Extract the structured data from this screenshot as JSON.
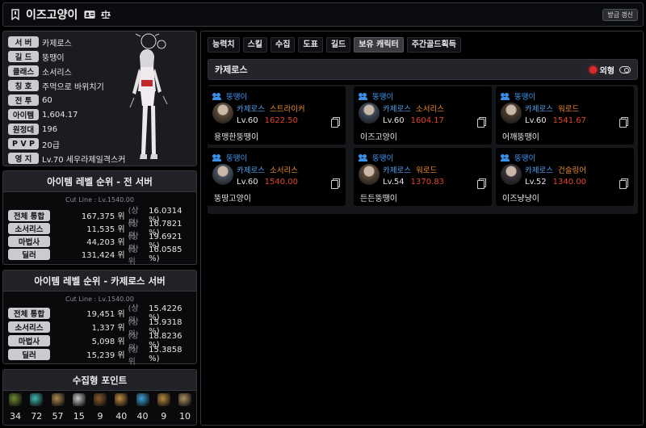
{
  "header": {
    "title": "이즈고양이",
    "refresh_label": "방금 갱신"
  },
  "profile": {
    "rows": [
      {
        "label": "서 버",
        "value": "카제로스"
      },
      {
        "label": "길 드",
        "value": "뚱땡이"
      },
      {
        "label": "클래스",
        "value": "소서리스"
      },
      {
        "label": "칭 호",
        "value": "주먹으로 바위치기"
      },
      {
        "label": "전 투",
        "value": "60"
      },
      {
        "label": "아이템",
        "value": "1,604.17"
      },
      {
        "label": "원정대",
        "value": "196"
      },
      {
        "label": "P V P",
        "value": "20급"
      },
      {
        "label": "영 지",
        "value": "Lv.70 세우라제일격스커"
      }
    ]
  },
  "rank_all": {
    "title": "아이템 레벨 순위 - 전 서버",
    "cutline": "Cut Line : Lv.1540.00",
    "rows": [
      {
        "label": "전체 통합",
        "rank": "167,375 위",
        "upper": "(상위",
        "pct": "16.0314 %)"
      },
      {
        "label": "소서리스",
        "rank": "11,535 위",
        "upper": "(상위",
        "pct": "16.7821 %)"
      },
      {
        "label": "마법사",
        "rank": "44,203 위",
        "upper": "(상위",
        "pct": "19.6921 %)"
      },
      {
        "label": "딜러",
        "rank": "131,424 위",
        "upper": "(상위",
        "pct": "16.0585 %)"
      }
    ]
  },
  "rank_server": {
    "title": "아이템 레벨 순위 - 카제로스 서버",
    "cutline": "Cut Line : Lv.1540.00",
    "rows": [
      {
        "label": "전체 통합",
        "rank": "19,451 위",
        "upper": "(상위",
        "pct": "15.4226 %)"
      },
      {
        "label": "소서리스",
        "rank": "1,337 위",
        "upper": "(상위",
        "pct": "15.9318 %)"
      },
      {
        "label": "마법사",
        "rank": "5,098 위",
        "upper": "(상위",
        "pct": "18.8236 %)"
      },
      {
        "label": "딜러",
        "rank": "15,239 위",
        "upper": "(상위",
        "pct": "15.3858 %)"
      }
    ]
  },
  "collect": {
    "title": "수집형 포인트",
    "items": [
      {
        "icon": "mokoko-seed-icon",
        "value": "34",
        "color": "#6f8a2e"
      },
      {
        "icon": "island-heart-icon",
        "value": "72",
        "color": "#3fb7b0"
      },
      {
        "icon": "great-art-icon",
        "value": "57",
        "color": "#b08850"
      },
      {
        "icon": "giant-heart-icon",
        "value": "15",
        "color": "#c9c9c9"
      },
      {
        "icon": "ignea-token-icon",
        "value": "9",
        "color": "#8a5a2a"
      },
      {
        "icon": "voyage-icon",
        "value": "40",
        "color": "#c08a40"
      },
      {
        "icon": "world-tree-leaf-icon",
        "value": "40",
        "color": "#3aa0d8"
      },
      {
        "icon": "orpheus-star-icon",
        "value": "9",
        "color": "#b88a3a"
      },
      {
        "icon": "orchestra-icon",
        "value": "10",
        "color": "#b09060"
      }
    ]
  },
  "tabs": [
    {
      "label": "능력치",
      "active": false
    },
    {
      "label": "스킬",
      "active": false
    },
    {
      "label": "수집",
      "active": false
    },
    {
      "label": "도표",
      "active": false
    },
    {
      "label": "길드",
      "active": false
    },
    {
      "label": "보유 캐릭터",
      "active": true
    },
    {
      "label": "주간골드획득",
      "active": false
    }
  ],
  "server_bar": {
    "name": "카제로스",
    "appearance_label": "외형"
  },
  "characters": [
    {
      "guild": "뚱땡이",
      "server": "카제로스",
      "class": "스트라이커",
      "level": "Lv.60",
      "item_level": "1622.50",
      "name": "용맹한뚱땡이",
      "portrait": "#5a4a3a"
    },
    {
      "guild": "뚱땡이",
      "server": "카제로스",
      "class": "소서리스",
      "level": "Lv.60",
      "item_level": "1604.17",
      "name": "이즈고양이",
      "portrait": "#3f4a5a"
    },
    {
      "guild": "뚱땡이",
      "server": "카제로스",
      "class": "워로드",
      "level": "Lv.60",
      "item_level": "1541.67",
      "name": "어깨뚱땡이",
      "portrait": "#4a3a2e"
    },
    {
      "guild": "뚱땡이",
      "server": "카제로스",
      "class": "소서리스",
      "level": "Lv.60",
      "item_level": "1540.00",
      "name": "뚱땅고양이",
      "portrait": "#4a5260"
    },
    {
      "guild": "뚱땡이",
      "server": "카제로스",
      "class": "워로드",
      "level": "Lv.54",
      "item_level": "1370.83",
      "name": "든든뚱땡이",
      "portrait": "#5a4a38"
    },
    {
      "guild": "뚱땡이",
      "server": "카제로스",
      "class": "건슬링어",
      "level": "Lv.52",
      "item_level": "1340.00",
      "name": "이즈냥냥이",
      "portrait": "#3a3238"
    }
  ]
}
